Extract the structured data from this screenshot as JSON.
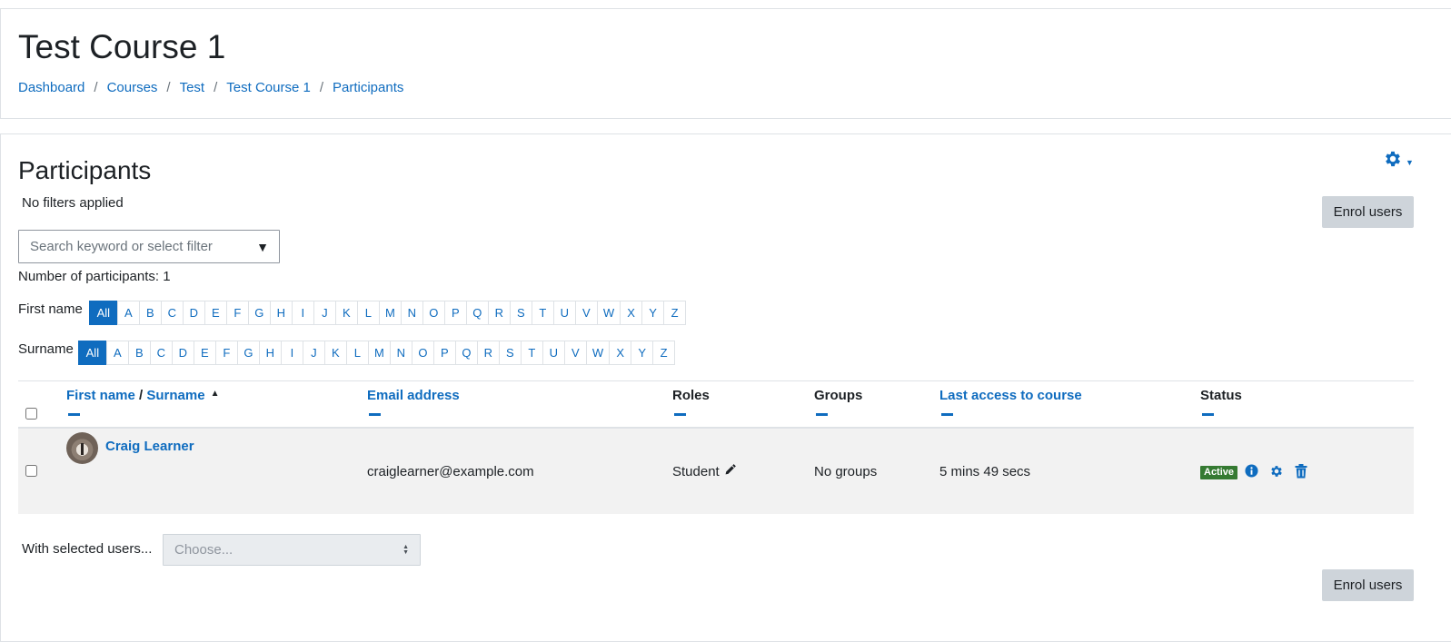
{
  "header": {
    "title": "Test Course 1",
    "breadcrumb": [
      "Dashboard",
      "Courses",
      "Test",
      "Test Course 1",
      "Participants"
    ],
    "separator": "/"
  },
  "participants": {
    "title": "Participants",
    "filter_status": "No filters applied",
    "enrol_button": "Enrol users",
    "search_placeholder": "Search keyword or select filter",
    "count_text": "Number of participants: 1",
    "first_name_label": "First name",
    "surname_label": "Surname",
    "initials": [
      "All",
      "A",
      "B",
      "C",
      "D",
      "E",
      "F",
      "G",
      "H",
      "I",
      "J",
      "K",
      "L",
      "M",
      "N",
      "O",
      "P",
      "Q",
      "R",
      "S",
      "T",
      "U",
      "V",
      "W",
      "X",
      "Y",
      "Z"
    ]
  },
  "table": {
    "headers": {
      "first_name": "First name",
      "slash": "/",
      "surname": "Surname",
      "email": "Email address",
      "roles": "Roles",
      "groups": "Groups",
      "last_access": "Last access to course",
      "status": "Status"
    },
    "rows": [
      {
        "name": "Craig Learner",
        "email": "craiglearner@example.com",
        "role": "Student",
        "groups": "No groups",
        "last_access": "5 mins 49 secs",
        "status": "Active"
      }
    ]
  },
  "bulk": {
    "label": "With selected users...",
    "select_value": "Choose..."
  },
  "colors": {
    "link": "#0f6cbf",
    "active_badge": "#357a32",
    "button_bg": "#ced4da",
    "row_bg": "#f2f2f2"
  },
  "icons": {
    "gear": "gear-icon",
    "info": "info-icon",
    "edit": "pencil-icon",
    "delete": "trash-icon"
  }
}
